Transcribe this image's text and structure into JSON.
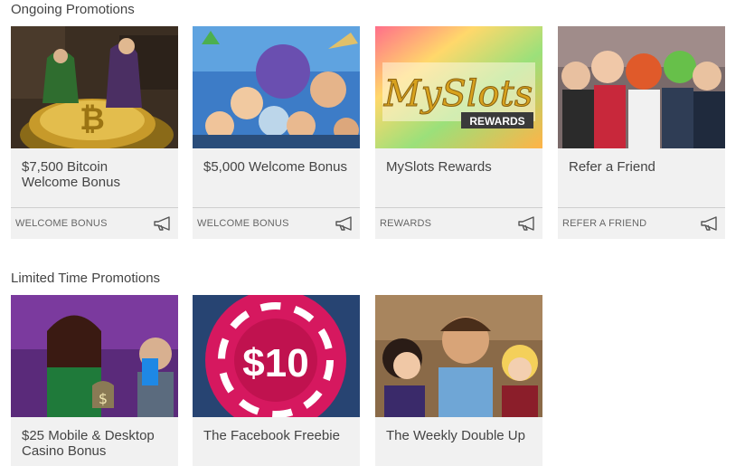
{
  "sections": {
    "ongoing": {
      "title": "Ongoing Promotions",
      "cards": [
        {
          "title": "$7,500 Bitcoin Welcome Bonus",
          "category": "WELCOME BONUS",
          "action_icon": "megaphone-icon"
        },
        {
          "title": "$5,000 Welcome Bonus",
          "category": "WELCOME BONUS",
          "action_icon": "megaphone-icon"
        },
        {
          "title": "MySlots Rewards",
          "category": "REWARDS",
          "action_icon": "megaphone-icon"
        },
        {
          "title": "Refer a Friend",
          "category": "REFER A FRIEND",
          "action_icon": "megaphone-icon"
        }
      ]
    },
    "limited": {
      "title": "Limited Time Promotions",
      "cards": [
        {
          "title": "$25 Mobile & Desktop Casino Bonus"
        },
        {
          "title": "The Facebook Freebie"
        },
        {
          "title": "The Weekly Double Up"
        }
      ]
    }
  },
  "images": {
    "myslots_logo_main": "MySlots",
    "myslots_logo_sub": "REWARDS",
    "chip_value": "$10"
  },
  "colors": {
    "card_bg": "#f1f1f1",
    "text": "#444444",
    "chip": "#d6185f",
    "myslots_gold": "#d8a21e"
  }
}
